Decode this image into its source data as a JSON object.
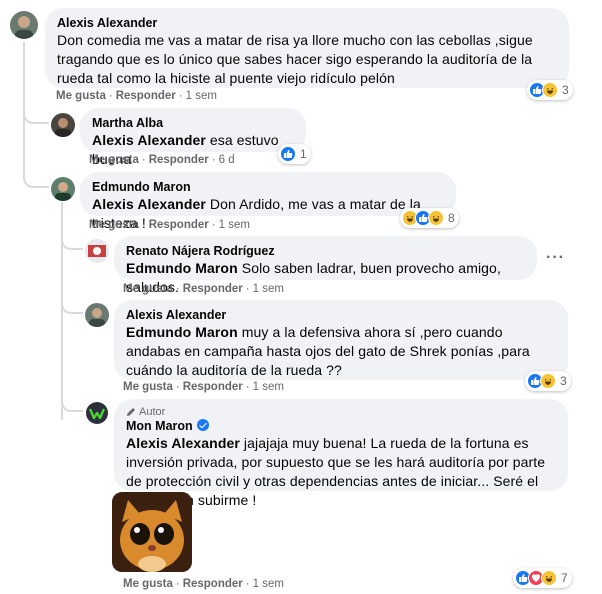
{
  "comments": [
    {
      "author": "Alexis Alexander",
      "text": "Don comedia me vas a matar de risa ya llore mucho con las cebollas ,sigue tragando que es lo único que sabes hacer sigo esperando la auditoría de la rueda tal como la hiciste al puente viejo ridículo pelón",
      "like": "Me gusta",
      "reply": "Responder",
      "time": "1 sem",
      "reaction_count": "3",
      "reactions": [
        "like-icon",
        "haha-icon"
      ]
    },
    {
      "author": "Martha Alba",
      "mention": "Alexis Alexander",
      "text": "esa estuvo buena",
      "like": "Me gusta",
      "reply": "Responder",
      "time": "6 d",
      "reaction_count": "1",
      "reactions": [
        "like-icon"
      ]
    },
    {
      "author": "Edmundo Maron",
      "mention": "Alexis Alexander",
      "text": "Don Ardido, me vas a matar de la tristeza !",
      "like": "Me gusta",
      "reply": "Responder",
      "time": "1 sem",
      "reaction_count": "8",
      "reactions": [
        "haha-icon",
        "like-icon",
        "haha-icon"
      ]
    },
    {
      "author": "Renato Nájera Rodríguez",
      "mention": "Edmundo Maron",
      "text": "Solo saben ladrar, buen provecho amigo, saludos.",
      "like": "Me gusta",
      "reply": "Responder",
      "time": "1 sem",
      "more": "···"
    },
    {
      "author": "Alexis Alexander",
      "mention": "Edmundo Maron",
      "text": "muy a la defensiva ahora sí ,pero cuando andabas en campaña hasta ojos del gato de Shrek ponías ,para cuándo la auditoría de la rueda ??",
      "like": "Me gusta",
      "reply": "Responder",
      "time": "1 sem",
      "reaction_count": "3",
      "reactions": [
        "like-icon",
        "haha-icon"
      ]
    },
    {
      "author_tag": "Autor",
      "author": "Mon Maron",
      "mention": "Alexis Alexander",
      "text": "jajajaja muy buena! La rueda de la fortuna es inversión privada, por supuesto que se les hará auditoría por parte de protección civil y otras dependencias antes de iniciar... Seré el primero en subirme !",
      "like": "Me gusta",
      "reply": "Responder",
      "time": "1 sem",
      "reaction_count": "7",
      "reactions": [
        "like-icon",
        "love-icon",
        "haha-icon"
      ]
    }
  ]
}
